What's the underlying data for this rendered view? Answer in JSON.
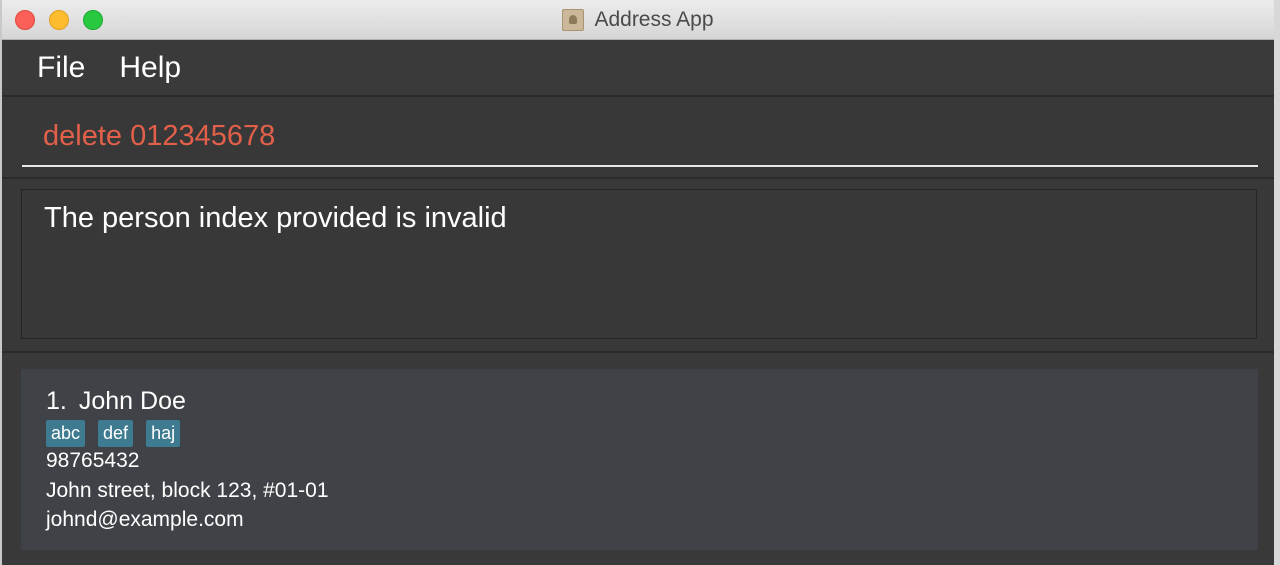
{
  "window": {
    "title": "Address App"
  },
  "menu": {
    "items": [
      "File",
      "Help"
    ]
  },
  "command_box": {
    "value": "delete 012345678"
  },
  "result_display": {
    "text": "The person index provided is invalid"
  },
  "person_list": [
    {
      "index": "1.",
      "name": "John Doe",
      "tags": [
        "abc",
        "def",
        "haj"
      ],
      "phone": "98765432",
      "address": "John street, block 123, #01-01",
      "email": "johnd@example.com"
    }
  ],
  "colors": {
    "command_text": "#e2604a",
    "tag_background": "#3e7b91",
    "background": "#3a3a3a"
  }
}
